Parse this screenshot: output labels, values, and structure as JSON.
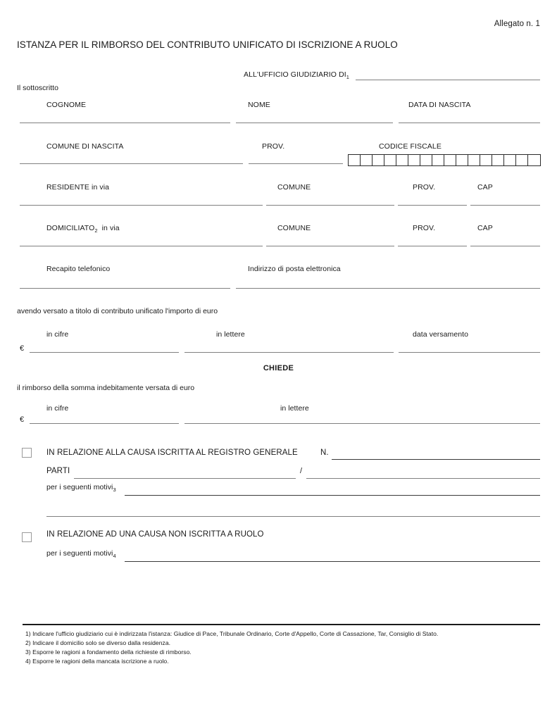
{
  "document": {
    "allegato": "Allegato n. 1",
    "title": "ISTANZA PER IL RIMBORSO DEL CONTRIBUTO UNIFICATO DI ISCRIZIONE A RUOLO"
  },
  "recipient": {
    "label": "ALL'UFFICIO GIUDIZIARIO DI",
    "footnote_marker": "1",
    "value": ""
  },
  "declarant": {
    "intro": "Il sottoscritto",
    "cognome_label": "COGNOME",
    "cognome_value": "",
    "nome_label": "NOME",
    "nome_value": "",
    "data_nascita_label": "DATA DI NASCITA",
    "data_nascita_value": "",
    "comune_nascita_label": "COMUNE DI NASCITA",
    "comune_nascita_value": "",
    "prov_nascita_label": "PROV.",
    "prov_nascita_value": "",
    "codice_fiscale_label": "CODICE FISCALE",
    "codice_fiscale_boxes": 16,
    "codice_fiscale_value": ""
  },
  "residence": {
    "label": "RESIDENTE in via",
    "via_value": "",
    "comune_label": "COMUNE",
    "comune_value": "",
    "prov_label": "PROV.",
    "prov_value": "",
    "cap_label": "CAP",
    "cap_value": ""
  },
  "domicile": {
    "label": "DOMICILIATO",
    "footnote_marker": "2",
    "label_suffix": "in via",
    "via_value": "",
    "comune_label": "COMUNE",
    "comune_value": "",
    "prov_label": "PROV.",
    "prov_value": "",
    "cap_label": "CAP",
    "cap_value": ""
  },
  "contacts": {
    "phone_label": "Recapito telefonico",
    "phone_value": "",
    "email_label": "Indirizzo di posta elettronica",
    "email_value": ""
  },
  "payment": {
    "intro": "avendo versato a titolo di contributo unificato l'importo di euro",
    "euro_symbol": "€",
    "in_cifre_label": "in cifre",
    "in_cifre_value": "",
    "in_lettere_label": "in lettere",
    "in_lettere_value": "",
    "data_versamento_label": "data versamento",
    "data_versamento_value": ""
  },
  "request": {
    "heading": "CHIEDE",
    "intro": "il rimborso della somma indebitamente versata di euro",
    "euro_symbol": "€",
    "in_cifre_label": "in cifre",
    "in_cifre_value": "",
    "in_lettere_label": "in lettere",
    "in_lettere_value": ""
  },
  "case_registered": {
    "checkbox_checked": false,
    "title": "IN RELAZIONE ALLA CAUSA ISCRITTA AL REGISTRO GENERALE",
    "numero_label": "N.",
    "numero_value": "",
    "parti_label": "PARTI",
    "parti_first_value": "",
    "parti_separator": "/",
    "parti_second_value": "",
    "motivi_label": "per i seguenti motivi",
    "motivi_marker": "3",
    "motivi_value": "",
    "motivi_value_line2": ""
  },
  "case_unregistered": {
    "checkbox_checked": false,
    "title": "IN RELAZIONE AD UNA CAUSA NON ISCRITTA A RUOLO",
    "motivi_label": "per i seguenti motivi",
    "motivi_marker": "4",
    "motivi_value": ""
  },
  "footnotes": [
    "1) Indicare l'ufficio giudiziario cui è indirizzata l'istanza: Giudice di Pace, Tribunale Ordinario, Corte d'Appello, Corte di Cassazione, Tar, Consiglio di Stato.",
    "2) Indicare il domicilio solo se diverso dalla residenza.",
    "3) Esporre le ragioni a fondamento della richieste di rimborso.",
    "4) Esporre le ragioni della mancata iscrizione a ruolo."
  ]
}
